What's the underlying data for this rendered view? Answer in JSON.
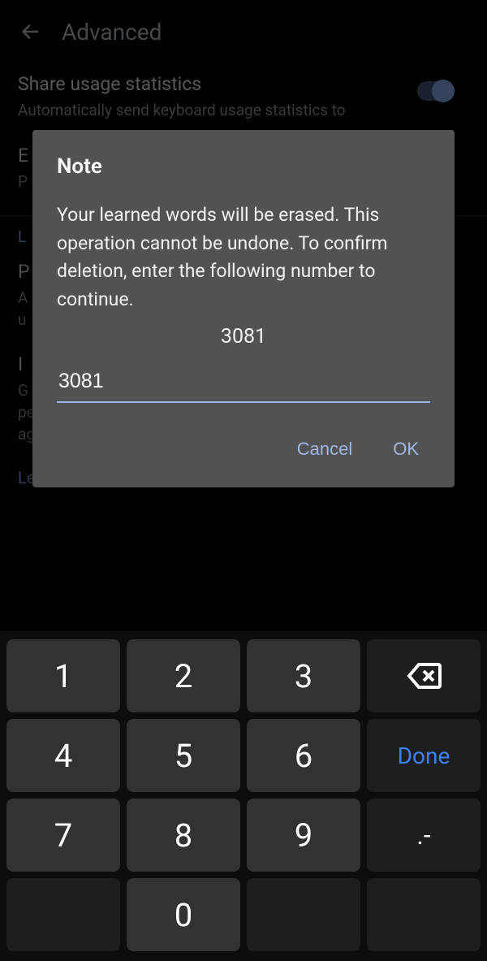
{
  "header": {
    "title": "Advanced"
  },
  "settings": {
    "share": {
      "title": "Share usage statistics",
      "desc": "Automatically send keyboard usage statistics to"
    },
    "emoji_row": {
      "title_prefix": "E",
      "desc_prefix": "P"
    },
    "section_label_prefix": "L",
    "perso_row": {
      "title_prefix": "P",
      "desc_prefix1": "A",
      "desc_prefix2": "u"
    },
    "improve": {
      "title_prefix": "I",
      "desc": "G\nyour device based on your usage patterns. With your permission, Gboard will use these improvements, in the aggregate, to update Google's voice and typing services."
    },
    "learn_more": "Learn more"
  },
  "dialog": {
    "title": "Note",
    "body": "Your learned words will be erased. This operation cannot be undone. To confirm deletion, enter the following number to continue.",
    "confirm_number": "3081",
    "input_value": "3081",
    "cancel": "Cancel",
    "ok": "OK"
  },
  "keypad": {
    "k1": "1",
    "k2": "2",
    "k3": "3",
    "k4": "4",
    "k5": "5",
    "k6": "6",
    "k7": "7",
    "k8": "8",
    "k9": "9",
    "k0": "0",
    "done": "Done",
    "symbol": ".-"
  }
}
